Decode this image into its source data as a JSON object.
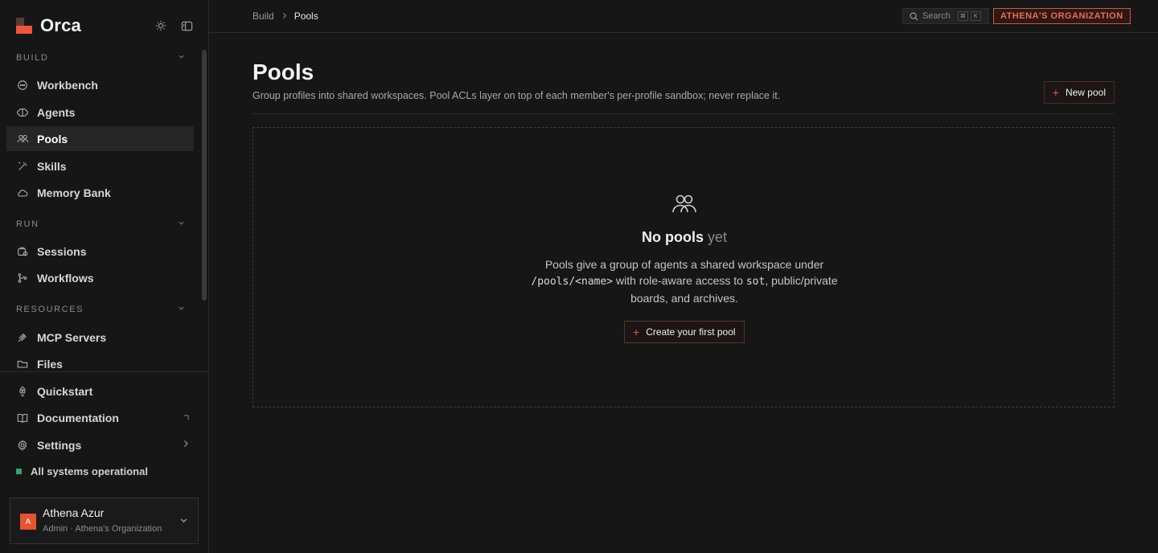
{
  "app": {
    "name": "Orca"
  },
  "sidebar": {
    "sections": {
      "build": "BUILD",
      "run": "RUN",
      "resources": "RESOURCES"
    },
    "build_items": [
      {
        "label": "Workbench",
        "icon": "chat-icon"
      },
      {
        "label": "Agents",
        "icon": "brain-icon"
      },
      {
        "label": "Pools",
        "icon": "users-icon",
        "active": true
      },
      {
        "label": "Skills",
        "icon": "magic-wand-icon"
      },
      {
        "label": "Memory Bank",
        "icon": "cloud-icon"
      }
    ],
    "run_items": [
      {
        "label": "Sessions",
        "icon": "session-icon"
      },
      {
        "label": "Workflows",
        "icon": "workflow-icon"
      }
    ],
    "resource_items": [
      {
        "label": "MCP Servers",
        "icon": "plug-icon"
      },
      {
        "label": "Files",
        "icon": "folder-icon"
      }
    ],
    "bottom_items": [
      {
        "label": "Quickstart",
        "icon": "rocket-icon"
      },
      {
        "label": "Documentation",
        "icon": "book-icon"
      },
      {
        "label": "Settings",
        "icon": "gear-icon"
      }
    ],
    "status": {
      "text": "All systems operational",
      "color": "#35a36b"
    },
    "user": {
      "initial": "A",
      "name": "Athena Azur",
      "subtitle": "Admin · Athena's Organization"
    }
  },
  "topbar": {
    "breadcrumb": [
      "Build",
      "Pools"
    ],
    "search": {
      "label": "Search",
      "keys": [
        "⌘",
        "K"
      ]
    },
    "org_badge": "ATHENA'S ORGANIZATION"
  },
  "main": {
    "title": "Pools",
    "description": "Group profiles into shared workspaces. Pool ACLs layer on top of each member's per-profile sandbox; never replace it.",
    "new_button": "New pool",
    "empty": {
      "title_strong": "No pools",
      "title_muted": "yet",
      "desc_part1": "Pools give a group of agents a shared workspace under",
      "desc_code1": "/pools/<name>",
      "desc_part2": "with role-aware access to",
      "desc_code2": "sot",
      "desc_part3": ", public/private boards, and archives.",
      "button": "Create your first pool"
    }
  },
  "colors": {
    "accent": "#e2583e",
    "org_badge": "#f06a4f"
  }
}
